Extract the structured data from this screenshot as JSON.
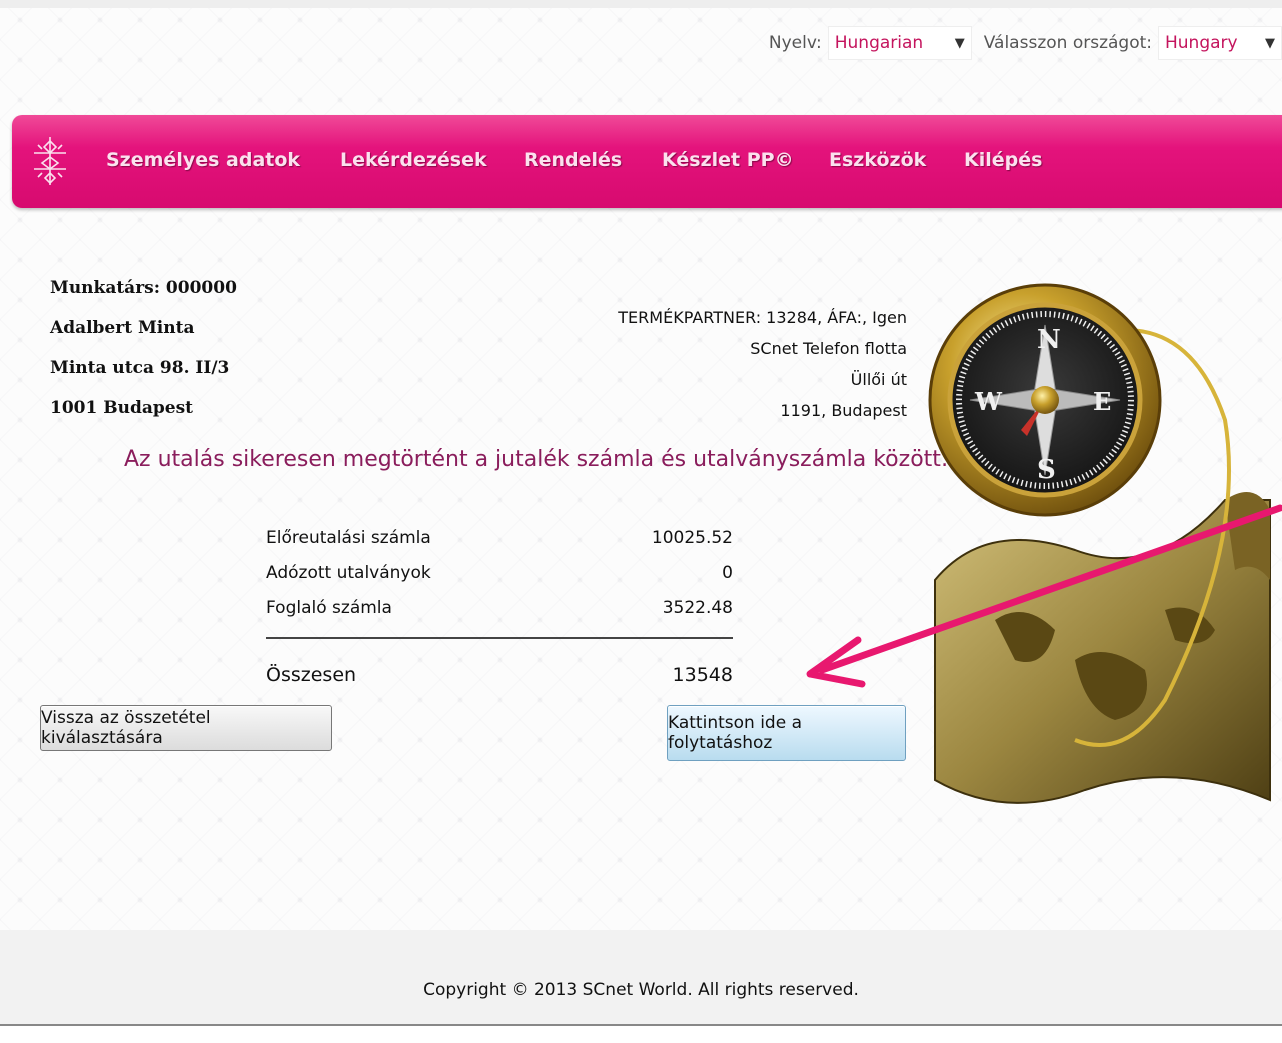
{
  "topbar": {
    "language_label": "Nyelv:",
    "language_value": "Hungarian",
    "country_label": "Válasszon országot:",
    "country_value": "Hungary"
  },
  "nav": {
    "items": [
      "Személyes adatok",
      "Lekérdezések",
      "Rendelés",
      "Készlet PP©",
      "Eszközök",
      "Kilépés"
    ]
  },
  "user": {
    "line1": "Munkatárs: 000000",
    "name": "Adalbert Minta",
    "address": "Minta utca 98. II/3",
    "city": "1001 Budapest"
  },
  "partner": {
    "line1": "TERMÉKPARTNER: 13284, ÁFA:, Igen",
    "line2": "SCnet Telefon flotta",
    "line3": "Üllői út",
    "line4": "1191, Budapest"
  },
  "message": "Az utalás sikeresen megtörtént a jutalék számla és utalványszámla között:",
  "summary": {
    "rows": [
      {
        "label": "Előreutalási számla",
        "value": "10025.52"
      },
      {
        "label": "Adózott utalványok",
        "value": "0"
      },
      {
        "label": "Foglaló számla",
        "value": "3522.48"
      }
    ],
    "total_label": "Összesen",
    "total_value": "13548"
  },
  "buttons": {
    "back": "Vissza az összetétel kiválasztására",
    "continue": "Kattintson ide a folytatáshoz"
  },
  "footer": "Copyright © 2013 SCnet World. All rights reserved.",
  "colors": {
    "brand_pink": "#e4137c",
    "heading_purple": "#8a1d5c",
    "annotation_arrow": "#e8186f"
  }
}
